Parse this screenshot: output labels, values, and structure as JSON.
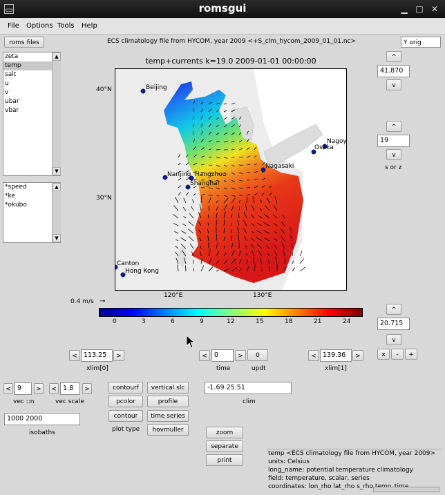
{
  "window": {
    "title": "romsgui"
  },
  "menu": [
    "File",
    "Options",
    "Tools",
    "Help"
  ],
  "toolbar": {
    "roms_files_label": "roms files",
    "file_title": "ECS climatology file from HYCOM, year 2009 <+S_clm_hycom_2009_01_01.nc>",
    "y_orig": "Y orig"
  },
  "variables": {
    "items": [
      "zeta",
      "temp",
      "salt",
      "u",
      "v",
      "ubar",
      "vbar"
    ],
    "selected": "temp"
  },
  "derived": {
    "items": [
      "*speed",
      "*ke",
      "*okubo"
    ]
  },
  "plot": {
    "title": "temp+currents k=19.0  2009-01-01 00:00:00",
    "lat_labels": [
      "40°N",
      "30°N"
    ],
    "lon_labels": [
      "120°E",
      "130°E"
    ],
    "cities": [
      "Beijing",
      "Nagoya",
      "Osaka",
      "Nagasaki",
      "Nanjing",
      "Hangzhou",
      "Shanghai",
      "Canton",
      "Hong Kong"
    ],
    "scale_label": "0.4 m/s",
    "colorbar_ticks": [
      "0",
      "3",
      "6",
      "9",
      "12",
      "15",
      "18",
      "21",
      "24"
    ],
    "colorbar_min": -1.69,
    "colorbar_max": 25.51
  },
  "right": {
    "up_label": "^",
    "down_label": "v",
    "ylim_top": "41.870",
    "level": "19",
    "s_or_z": "s or z",
    "ylim_bottom": "20.715",
    "zoom_x": "x",
    "zoom_minus": "-",
    "zoom_plus": "+"
  },
  "controls": {
    "left_arrow": "<",
    "right_arrow": ">",
    "xlim0_value": "113.25",
    "xlim0_label": "xlim[0]",
    "time_value": "0",
    "time_label": "time",
    "updt_value": "0",
    "updt_label": "updt",
    "xlim1_value": "139.36",
    "xlim1_label": "xlim[1]",
    "vec_n_value": "9",
    "vec_n_label": "vec ::n",
    "vec_scale_value": "1.8",
    "vec_scale_label": "vec scale",
    "isobaths_value": "1000 2000",
    "isobaths_label": "isobaths",
    "clim_value": "-1.69 25.51",
    "clim_label": "clim",
    "plot_type_label": "plot type"
  },
  "plot_buttons": {
    "contourf": "contourf",
    "pcolor": "pcolor",
    "contour": "contour",
    "vertical_slc": "vertical slc",
    "profile": "profile",
    "time_series": "time series",
    "hovmuller": "hovmuller"
  },
  "actions": {
    "zoom": "zoom",
    "separate": "separate",
    "print": "print"
  },
  "info": [
    "temp <ECS climatology file from HYCOM, year 2009>",
    "units: Celsius",
    "long_name: potential temperature climatology",
    "field: temperature, scalar, series",
    "coordinates: lon_rho lat_rho s_rho temp_time"
  ]
}
